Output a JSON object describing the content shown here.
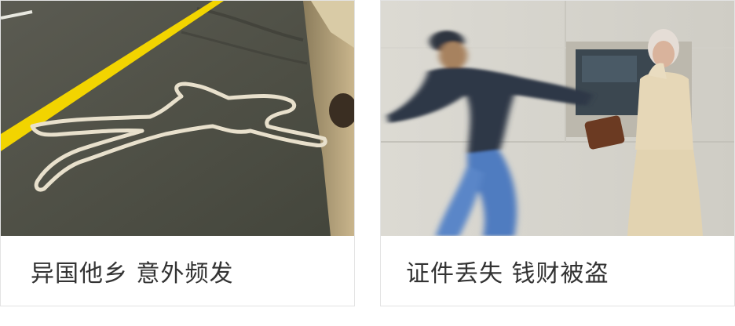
{
  "cards": [
    {
      "caption": "异国他乡 意外频发",
      "image_subject": "chalk-body-outline-on-road"
    },
    {
      "caption": "证件丢失  钱财被盗",
      "image_subject": "thief-running-from-atm"
    }
  ],
  "colors": {
    "caption_text": "#333333",
    "card_border": "#e3e3e3",
    "road_line": "#f2d400"
  }
}
